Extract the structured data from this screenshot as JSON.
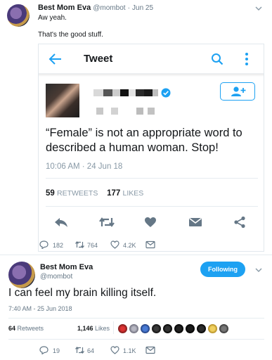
{
  "top_tweet": {
    "name": "Best Mom Eva",
    "handle": "@mombot",
    "sep": "·",
    "date": "Jun 25",
    "line1": "Aw yeah.",
    "line2": "That's the good stuff.",
    "actions": {
      "replies": "182",
      "retweets": "764",
      "likes": "4.2K"
    }
  },
  "embedded": {
    "header_title": "Tweet",
    "quote": "“Female” is not an appropriate word to described a human woman. Stop!",
    "time": "10:06 AM · 24 Jun 18",
    "retweet_count": "59",
    "retweet_label": "RETWEETS",
    "like_count": "177",
    "like_label": "LIKES"
  },
  "main_tweet": {
    "name": "Best Mom Eva",
    "handle": "@mombot",
    "follow_label": "Following",
    "text": "I can feel my brain killing itself.",
    "time": "7:40 AM - 25 Jun 2018",
    "retweets": "64",
    "retweets_label": "Retweets",
    "likes": "1,146",
    "likes_label": "Likes",
    "actions": {
      "replies": "19",
      "retweets": "64",
      "likes": "1.1K"
    }
  },
  "colors": {
    "accent": "#1da1f2",
    "muted": "#657786",
    "border": "#e1e8ed"
  },
  "icons": [
    "chevron-down-icon",
    "back-arrow-icon",
    "search-icon",
    "more-vertical-icon",
    "verified-icon",
    "follow-add-icon",
    "reply-icon",
    "retweet-icon",
    "heart-icon",
    "message-icon",
    "share-icon"
  ]
}
